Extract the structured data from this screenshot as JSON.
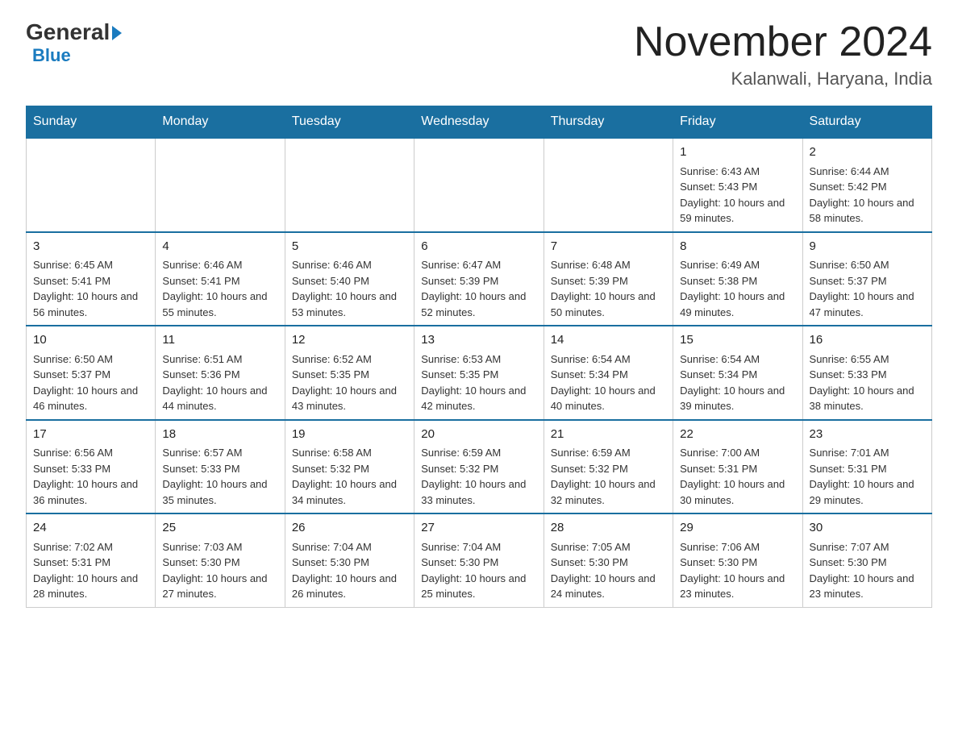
{
  "header": {
    "logo_general": "General",
    "logo_blue": "Blue",
    "title": "November 2024",
    "subtitle": "Kalanwali, Haryana, India"
  },
  "weekdays": [
    "Sunday",
    "Monday",
    "Tuesday",
    "Wednesday",
    "Thursday",
    "Friday",
    "Saturday"
  ],
  "weeks": [
    [
      {
        "day": "",
        "info": ""
      },
      {
        "day": "",
        "info": ""
      },
      {
        "day": "",
        "info": ""
      },
      {
        "day": "",
        "info": ""
      },
      {
        "day": "",
        "info": ""
      },
      {
        "day": "1",
        "info": "Sunrise: 6:43 AM\nSunset: 5:43 PM\nDaylight: 10 hours and 59 minutes."
      },
      {
        "day": "2",
        "info": "Sunrise: 6:44 AM\nSunset: 5:42 PM\nDaylight: 10 hours and 58 minutes."
      }
    ],
    [
      {
        "day": "3",
        "info": "Sunrise: 6:45 AM\nSunset: 5:41 PM\nDaylight: 10 hours and 56 minutes."
      },
      {
        "day": "4",
        "info": "Sunrise: 6:46 AM\nSunset: 5:41 PM\nDaylight: 10 hours and 55 minutes."
      },
      {
        "day": "5",
        "info": "Sunrise: 6:46 AM\nSunset: 5:40 PM\nDaylight: 10 hours and 53 minutes."
      },
      {
        "day": "6",
        "info": "Sunrise: 6:47 AM\nSunset: 5:39 PM\nDaylight: 10 hours and 52 minutes."
      },
      {
        "day": "7",
        "info": "Sunrise: 6:48 AM\nSunset: 5:39 PM\nDaylight: 10 hours and 50 minutes."
      },
      {
        "day": "8",
        "info": "Sunrise: 6:49 AM\nSunset: 5:38 PM\nDaylight: 10 hours and 49 minutes."
      },
      {
        "day": "9",
        "info": "Sunrise: 6:50 AM\nSunset: 5:37 PM\nDaylight: 10 hours and 47 minutes."
      }
    ],
    [
      {
        "day": "10",
        "info": "Sunrise: 6:50 AM\nSunset: 5:37 PM\nDaylight: 10 hours and 46 minutes."
      },
      {
        "day": "11",
        "info": "Sunrise: 6:51 AM\nSunset: 5:36 PM\nDaylight: 10 hours and 44 minutes."
      },
      {
        "day": "12",
        "info": "Sunrise: 6:52 AM\nSunset: 5:35 PM\nDaylight: 10 hours and 43 minutes."
      },
      {
        "day": "13",
        "info": "Sunrise: 6:53 AM\nSunset: 5:35 PM\nDaylight: 10 hours and 42 minutes."
      },
      {
        "day": "14",
        "info": "Sunrise: 6:54 AM\nSunset: 5:34 PM\nDaylight: 10 hours and 40 minutes."
      },
      {
        "day": "15",
        "info": "Sunrise: 6:54 AM\nSunset: 5:34 PM\nDaylight: 10 hours and 39 minutes."
      },
      {
        "day": "16",
        "info": "Sunrise: 6:55 AM\nSunset: 5:33 PM\nDaylight: 10 hours and 38 minutes."
      }
    ],
    [
      {
        "day": "17",
        "info": "Sunrise: 6:56 AM\nSunset: 5:33 PM\nDaylight: 10 hours and 36 minutes."
      },
      {
        "day": "18",
        "info": "Sunrise: 6:57 AM\nSunset: 5:33 PM\nDaylight: 10 hours and 35 minutes."
      },
      {
        "day": "19",
        "info": "Sunrise: 6:58 AM\nSunset: 5:32 PM\nDaylight: 10 hours and 34 minutes."
      },
      {
        "day": "20",
        "info": "Sunrise: 6:59 AM\nSunset: 5:32 PM\nDaylight: 10 hours and 33 minutes."
      },
      {
        "day": "21",
        "info": "Sunrise: 6:59 AM\nSunset: 5:32 PM\nDaylight: 10 hours and 32 minutes."
      },
      {
        "day": "22",
        "info": "Sunrise: 7:00 AM\nSunset: 5:31 PM\nDaylight: 10 hours and 30 minutes."
      },
      {
        "day": "23",
        "info": "Sunrise: 7:01 AM\nSunset: 5:31 PM\nDaylight: 10 hours and 29 minutes."
      }
    ],
    [
      {
        "day": "24",
        "info": "Sunrise: 7:02 AM\nSunset: 5:31 PM\nDaylight: 10 hours and 28 minutes."
      },
      {
        "day": "25",
        "info": "Sunrise: 7:03 AM\nSunset: 5:30 PM\nDaylight: 10 hours and 27 minutes."
      },
      {
        "day": "26",
        "info": "Sunrise: 7:04 AM\nSunset: 5:30 PM\nDaylight: 10 hours and 26 minutes."
      },
      {
        "day": "27",
        "info": "Sunrise: 7:04 AM\nSunset: 5:30 PM\nDaylight: 10 hours and 25 minutes."
      },
      {
        "day": "28",
        "info": "Sunrise: 7:05 AM\nSunset: 5:30 PM\nDaylight: 10 hours and 24 minutes."
      },
      {
        "day": "29",
        "info": "Sunrise: 7:06 AM\nSunset: 5:30 PM\nDaylight: 10 hours and 23 minutes."
      },
      {
        "day": "30",
        "info": "Sunrise: 7:07 AM\nSunset: 5:30 PM\nDaylight: 10 hours and 23 minutes."
      }
    ]
  ]
}
